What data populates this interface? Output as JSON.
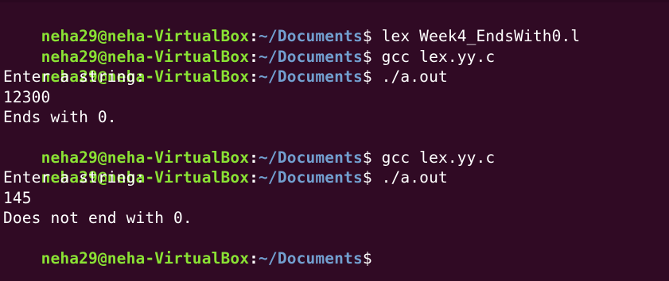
{
  "terminal": {
    "colors": {
      "background": "#300a24",
      "user_host": "#8ae234",
      "path": "#729fcf",
      "text": "#ffffff"
    },
    "lines": [
      {
        "type": "prompt",
        "user_host": "neha29@neha-VirtualBox",
        "sep": ":",
        "path": "~/Documents",
        "dollar": "$",
        "command": " lex Week4_EndsWith0.l"
      },
      {
        "type": "prompt",
        "user_host": "neha29@neha-VirtualBox",
        "sep": ":",
        "path": "~/Documents",
        "dollar": "$",
        "command": " gcc lex.yy.c"
      },
      {
        "type": "prompt",
        "user_host": "neha29@neha-VirtualBox",
        "sep": ":",
        "path": "~/Documents",
        "dollar": "$",
        "command": " ./a.out"
      },
      {
        "type": "output",
        "text": "Enter a string:"
      },
      {
        "type": "output",
        "text": "12300"
      },
      {
        "type": "output",
        "text": "Ends with 0."
      },
      {
        "type": "prompt",
        "user_host": "neha29@neha-VirtualBox",
        "sep": ":",
        "path": "~/Documents",
        "dollar": "$",
        "command": " gcc lex.yy.c"
      },
      {
        "type": "prompt",
        "user_host": "neha29@neha-VirtualBox",
        "sep": ":",
        "path": "~/Documents",
        "dollar": "$",
        "command": " ./a.out"
      },
      {
        "type": "output",
        "text": "Enter a string:"
      },
      {
        "type": "output",
        "text": "145"
      },
      {
        "type": "output",
        "text": "Does not end with 0."
      },
      {
        "type": "prompt",
        "user_host": "neha29@neha-VirtualBox",
        "sep": ":",
        "path": "~/Documents",
        "dollar": "$",
        "command": ""
      }
    ]
  }
}
